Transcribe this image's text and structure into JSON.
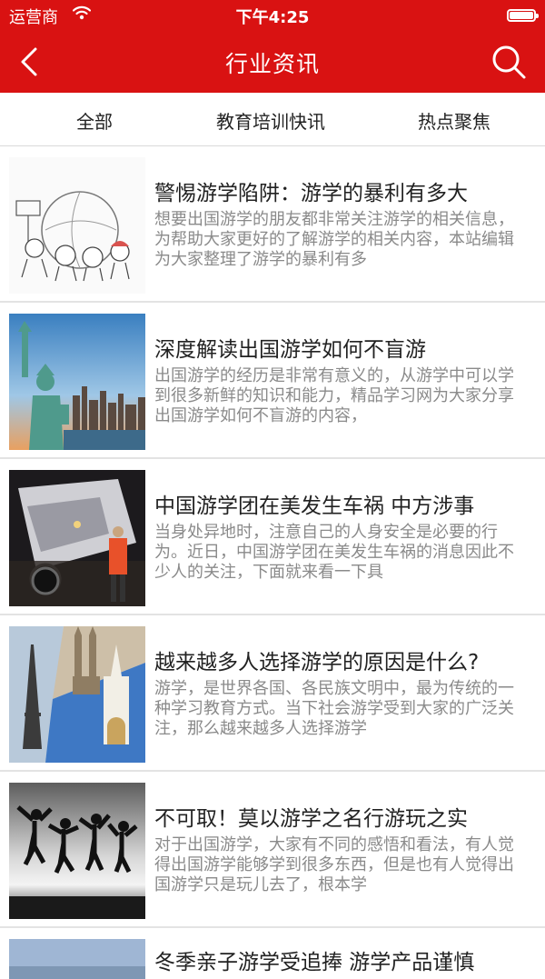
{
  "status_bar": {
    "carrier": "运营商",
    "time": "下午4:25",
    "battery_level": 1.0
  },
  "nav": {
    "title": "行业资讯",
    "back_icon": "chevron-left-icon",
    "search_icon": "search-icon"
  },
  "tabs": [
    {
      "label": "全部"
    },
    {
      "label": "教育培训快讯"
    },
    {
      "label": "热点聚焦"
    }
  ],
  "articles": [
    {
      "title": "警惕游学陷阱：游学的暴利有多大",
      "summary": "想要出国游学的朋友都非常关注游学的相关信息，为帮助大家更好的了解游学的相关内容，本站编辑为大家整理了游学的暴利有多",
      "image": "cartoon-travelers-image"
    },
    {
      "title": "深度解读出国游学如何不盲游",
      "summary": "出国游学的经历是非常有意义的，从游学中可以学到很多新鲜的知识和能力，精品学习网为大家分享出国游学如何不盲游的内容，",
      "image": "statue-of-liberty-image"
    },
    {
      "title": "中国游学团在美发生车祸 中方涉事",
      "summary": "当身处异地时，注意自己的人身安全是必要的行为。近日，中国游学团在美发生车祸的消息因此不少人的关注，下面就来看一下具",
      "image": "car-accident-image"
    },
    {
      "title": "越来越多人选择游学的原因是什么?",
      "summary": "游学，是世界各国、各民族文明中，最为传统的一种学习教育方式。当下社会游学受到大家的广泛关注，那么越来越多人选择游学",
      "image": "landmarks-collage-image"
    },
    {
      "title": "不可取！莫以游学之名行游玩之实",
      "summary": "对于出国游学，大家有不同的感悟和看法，有人觉得出国游学能够学到很多东西，但是也有人觉得出国游学只是玩儿去了，根本学",
      "image": "jumping-silhouettes-image"
    },
    {
      "title": "冬季亲子游学受追捧 游学产品谨慎",
      "image": "sky-landscape-image"
    }
  ],
  "colors": {
    "brand": "#d91212",
    "title_text": "#222222",
    "summary_text": "#8a8a8a",
    "divider": "#e3e3e3"
  }
}
